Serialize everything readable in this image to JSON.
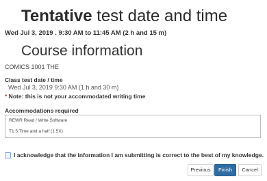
{
  "header": {
    "title_strong": "Tentative",
    "title_rest": " test date and time",
    "schedule": "Wed Jul 3, 2019 . 9:30 AM to 11:45 AM (2 h and 15 m)"
  },
  "course": {
    "heading": "Course information",
    "name": "COMICS 1001 THE",
    "test_label": "Class test date / time",
    "test_value": "Wed Jul 3, 2019 9:30 AM (1 h and 30 m)",
    "note_star": "*",
    "note_text": " Note: this is not your accommodated writing time"
  },
  "accommodations": {
    "label": "Accommodations required",
    "items": [
      "REWR Read / Write Software",
      "T1.5 Time and a half (1.5X)"
    ]
  },
  "acknowledge": {
    "text": "I acknowledge that the information I am submitting is correct to the best of my knowledge.",
    "checked": false
  },
  "buttons": {
    "previous": "Previous",
    "finish": "Finish",
    "cancel": "Cancel"
  }
}
